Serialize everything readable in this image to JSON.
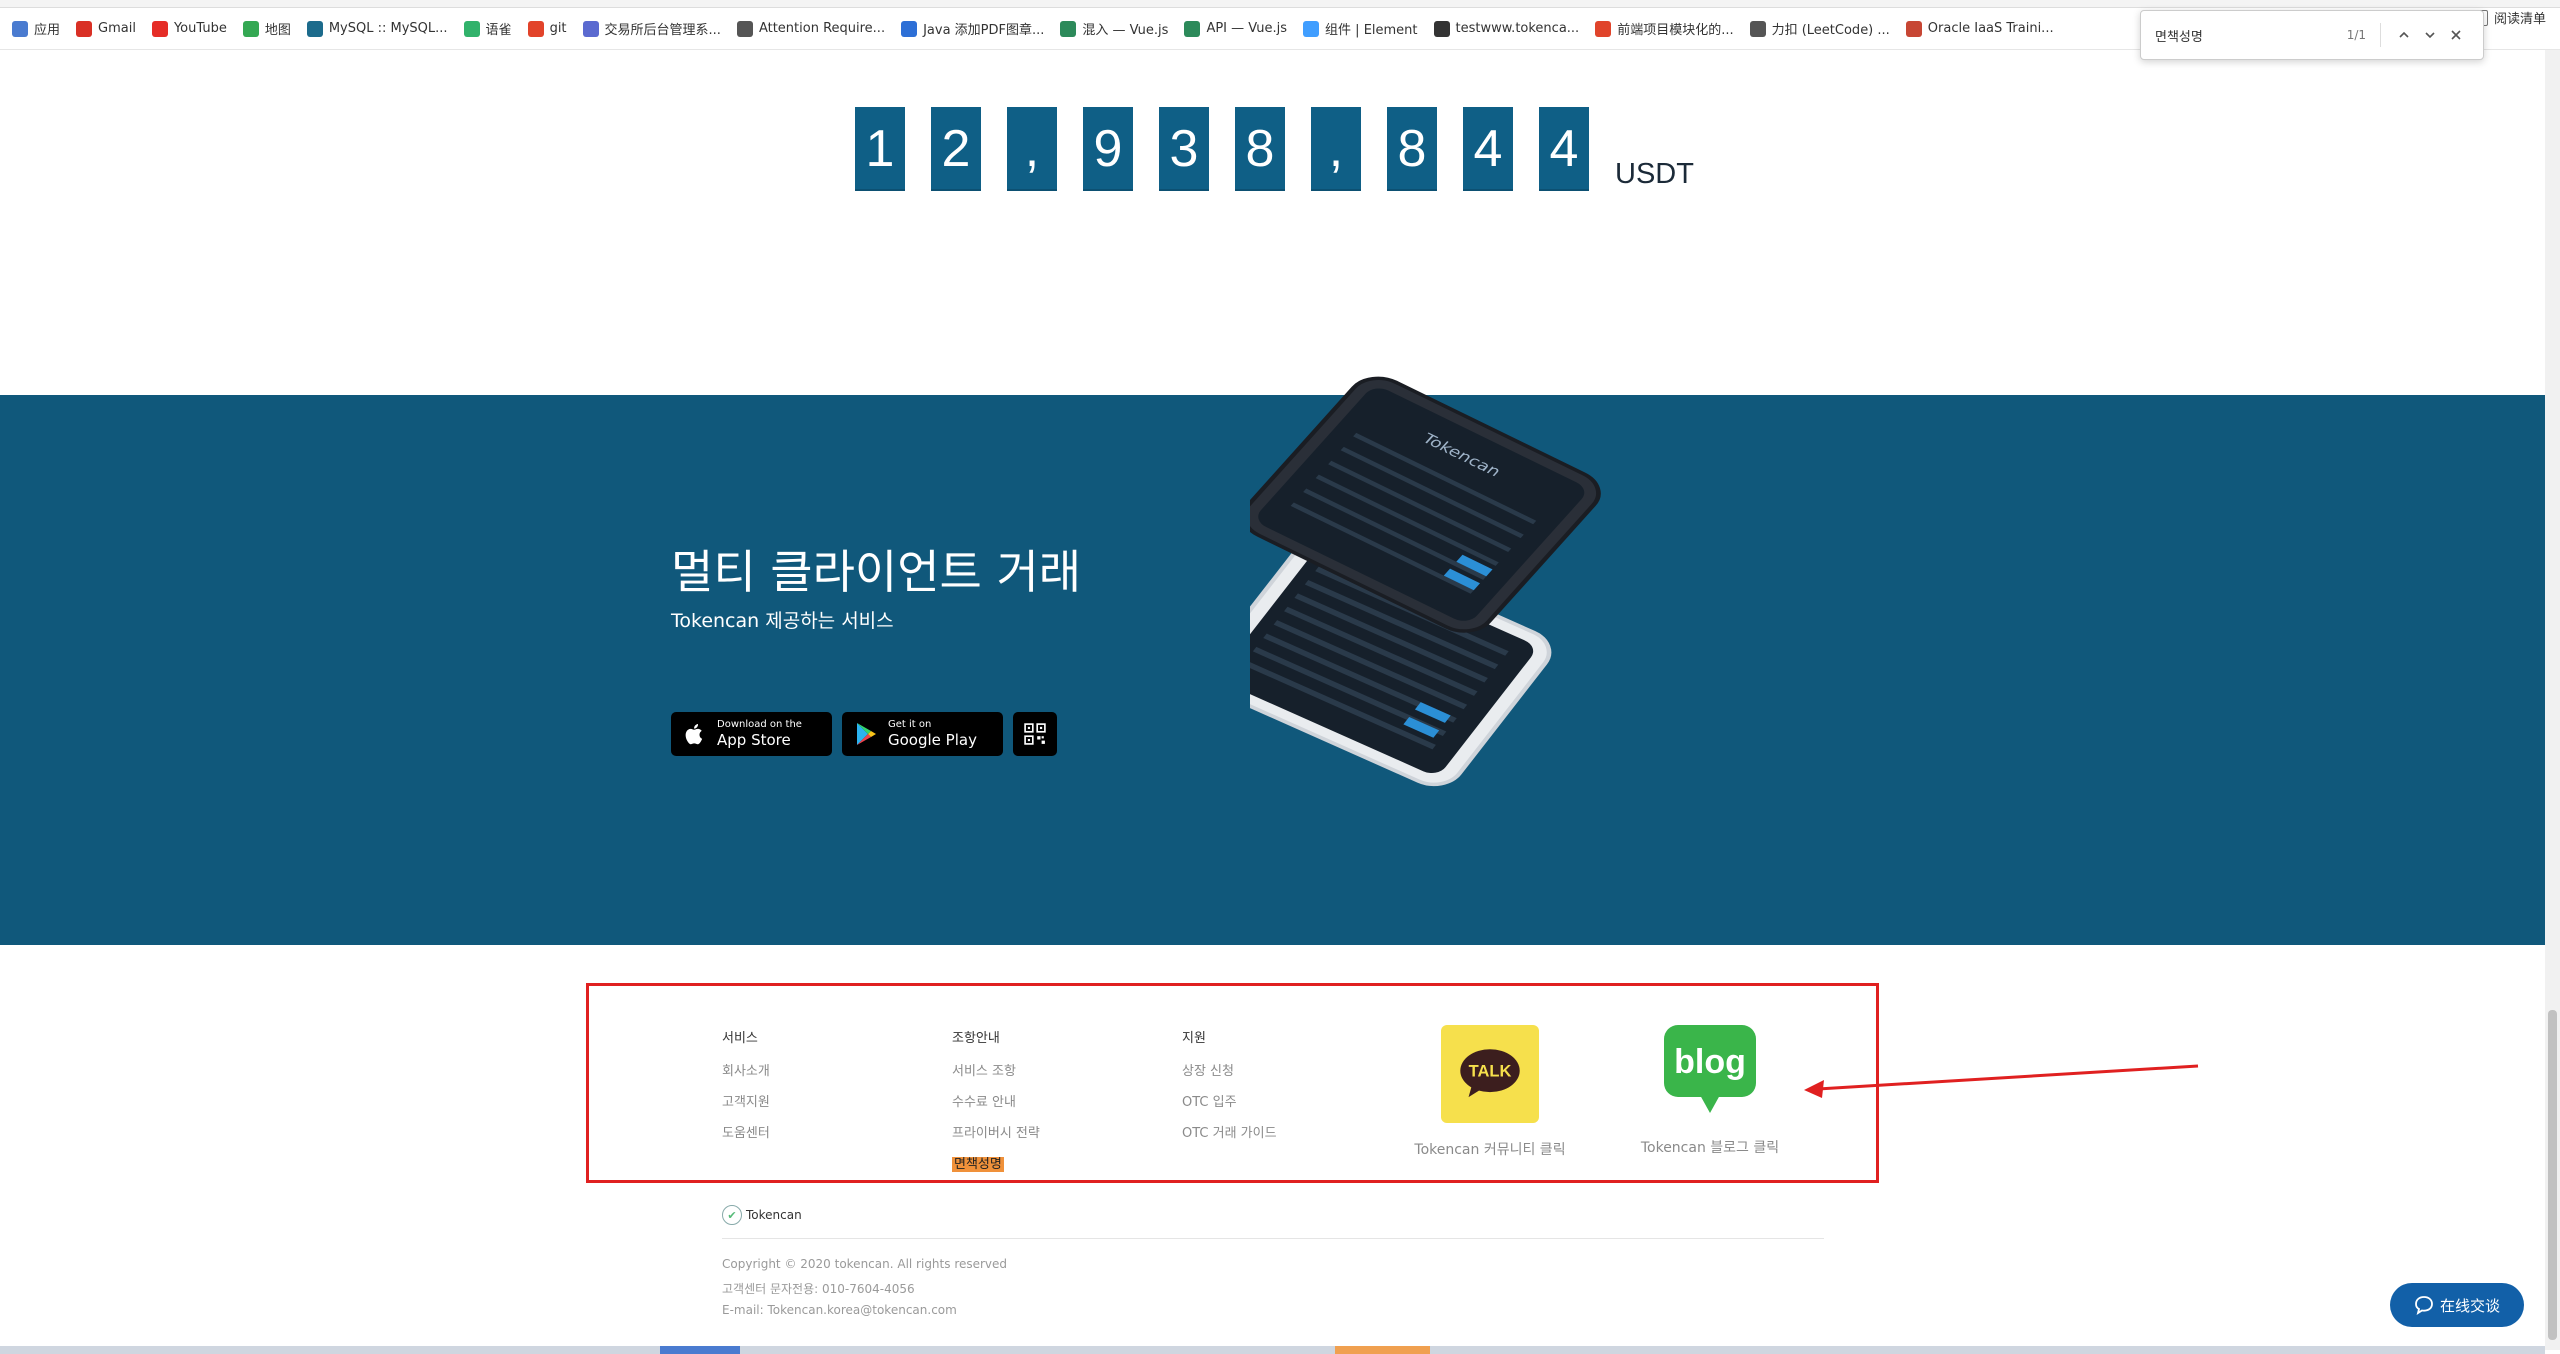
{
  "bookmarks": [
    {
      "label": "应用",
      "color": "#4a7bd0"
    },
    {
      "label": "Gmail",
      "color": "#d93025"
    },
    {
      "label": "YouTube",
      "color": "#e52d27"
    },
    {
      "label": "地图",
      "color": "#34a853"
    },
    {
      "label": "MySQL :: MySQL...",
      "color": "#1c6b8c"
    },
    {
      "label": "语雀",
      "color": "#31b26b"
    },
    {
      "label": "git",
      "color": "#e2432a"
    },
    {
      "label": "交易所后台管理系...",
      "color": "#5b6ad0"
    },
    {
      "label": "Attention Require...",
      "color": "#555555"
    },
    {
      "label": "Java 添加PDF图章...",
      "color": "#2d6fd6"
    },
    {
      "label": "混入 — Vue.js",
      "color": "#2c8a5a"
    },
    {
      "label": "API — Vue.js",
      "color": "#2c8a5a"
    },
    {
      "label": "组件 | Element",
      "color": "#409eff"
    },
    {
      "label": "testwww.tokenca...",
      "color": "#333333"
    },
    {
      "label": "前端项目模块化的...",
      "color": "#e0442b"
    },
    {
      "label": "力扣 (LeetCode) ...",
      "color": "#555555"
    },
    {
      "label": "Oracle IaaS Traini...",
      "color": "#c74634"
    }
  ],
  "reading_list": "阅读清单",
  "findbar": {
    "query": "면책성명",
    "count": "1/1"
  },
  "counter": {
    "digits": [
      "1",
      "2",
      ",",
      "9",
      "3",
      "8",
      ",",
      "8",
      "4",
      "4"
    ],
    "unit": "USDT"
  },
  "promo": {
    "title": "멀티 클라이언트 거래",
    "subtitle": "Tokencan 제공하는 서비스",
    "appstore": {
      "line1": "Download on the",
      "line2": "App Store"
    },
    "googleplay": {
      "line1": "Get it on",
      "line2": "Google Play"
    }
  },
  "phone": {
    "brand": "Tokencan"
  },
  "footer": {
    "col1": {
      "heading": "서비스",
      "links": [
        "회사소개",
        "고객지원",
        "도움센터"
      ]
    },
    "col2": {
      "heading": "조항안내",
      "links": [
        "서비스 조항",
        "수수료 안내",
        "프라이버시 전략",
        "면책성명"
      ]
    },
    "col3": {
      "heading": "지원",
      "links": [
        "상장 신청",
        "OTC 입주",
        "OTC 거래 가이드"
      ]
    },
    "talk": {
      "icon_text": "TALK",
      "label": "Tokencan 커뮤니티 클릭"
    },
    "blog": {
      "icon_text": "blog",
      "label": "Tokencan 블로그 클릭"
    },
    "logo": "Tokencan",
    "copyright": "Copyright © 2020 tokencan. All rights reserved",
    "phone": "고객센터 문자전용: 010-7604-4056",
    "email": "E-mail: Tokencan.korea@tokencan.com"
  },
  "chat": {
    "label": "在线交谈"
  },
  "colors": {
    "band": "#10587b",
    "digit": "#0f5f86",
    "highlight": "#f0913a",
    "annotation": "#e02020"
  }
}
